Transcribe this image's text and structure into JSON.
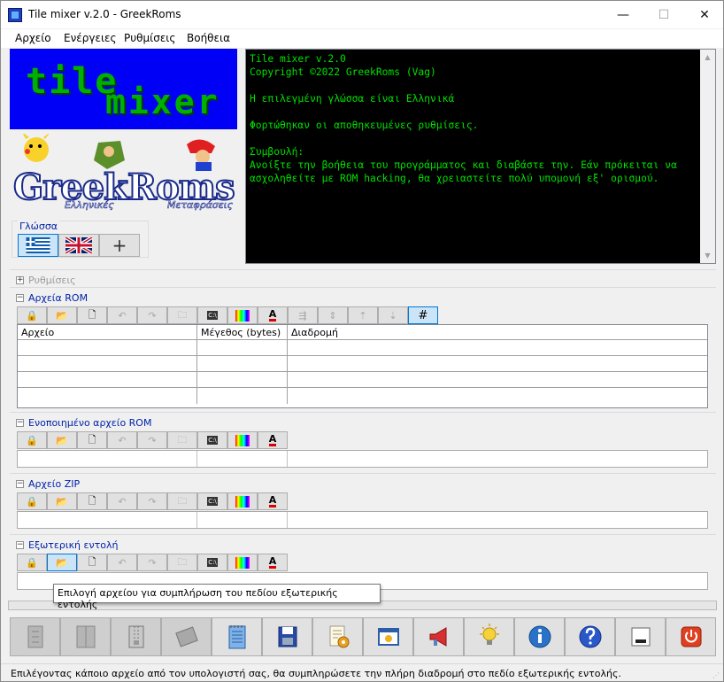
{
  "window": {
    "title": "Tile mixer v.2.0 - GreekRoms",
    "min_glyph": "—",
    "max_glyph": "☐",
    "close_glyph": "✕"
  },
  "menu": [
    "Αρχείο",
    "Ενέργειες",
    "Ρυθμίσεις",
    "Βοήθεια"
  ],
  "logo": {
    "line1": "tile",
    "line2": "mixer"
  },
  "brand": {
    "name": "GreekRoms",
    "left_tag": "Ελληνικές",
    "right_tag": "Μεταφράσεις"
  },
  "language": {
    "legend": "Γλώσσα",
    "add_label": "+",
    "options": [
      "greek-flag",
      "uk-flag",
      "plus-icon"
    ],
    "selected": "greek-flag"
  },
  "console": {
    "lines": "Tile mixer v.2.0\nCopyright ©2022 GreekRoms (Vag)\n\nΗ επιλεγμένη γλώσσα είναι Ελληνικά\n\nΦορτώθηκαν οι αποθηκευμένες ρυθμίσεις.\n\nΣυμβουλή:\nΑνοίξτε την βοήθεια του προγράμματος και διαβάστε την. Εάν πρόκειται να ασχοληθείτε με ROM hacking, θα χρειαστείτε πολύ υπομονή εξ' ορισμού.",
    "text_color": "#00e000",
    "bg_color": "#000000"
  },
  "sections": {
    "settings": {
      "title": "Ρυθμίσεις",
      "expander": "+"
    },
    "rom_files": {
      "title": "Αρχεία ROM",
      "expander": "−",
      "columns": [
        "Αρχείο",
        "Μέγεθος (bytes)",
        "Διαδρομή"
      ]
    },
    "merged_rom": {
      "title": "Ενοποιημένο αρχείο ROM",
      "expander": "−"
    },
    "zip_file": {
      "title": "Αρχείο ZIP",
      "expander": "−"
    },
    "external_cmd": {
      "title": "Εξωτερική εντολή",
      "expander": "−"
    }
  },
  "toolbar_icons": {
    "rom": [
      "lock-icon",
      "open-folder-icon",
      "new-file-icon",
      "undo-icon",
      "redo-icon",
      "folder-icon",
      "console-icon",
      "palette-icon",
      "font-color-icon",
      "move-icon",
      "sort-icon",
      "move-up-icon",
      "move-down-icon",
      "grid-icon"
    ],
    "common": [
      "lock-icon",
      "open-folder-icon",
      "new-file-icon",
      "undo-icon",
      "redo-icon",
      "folder-icon",
      "console-icon",
      "palette-icon",
      "font-color-icon"
    ],
    "console_glyph": "C:\\"
  },
  "tooltip": "Επιλογή αρχείου για συμπλήρωση του πεδίου εξωτερικής εντολής",
  "bottom_buttons": [
    "split-icon",
    "merge-icon",
    "zip-icon",
    "archive-icon",
    "notepad-icon",
    "save-icon",
    "settings-doc-icon",
    "window-icon",
    "announce-icon",
    "idea-icon",
    "info-icon",
    "help-icon",
    "minimize-icon",
    "power-icon"
  ],
  "status": "Επιλέγοντας κάποιο αρχείο από τον υπολογιστή σας, θα συμπληρώσετε την πλήρη διαδρομή στο πεδίο εξωτερικής εντολής.",
  "colors": {
    "accent": "#0078d7",
    "section_title": "#0022aa",
    "logo_bg": "#0000f6"
  }
}
